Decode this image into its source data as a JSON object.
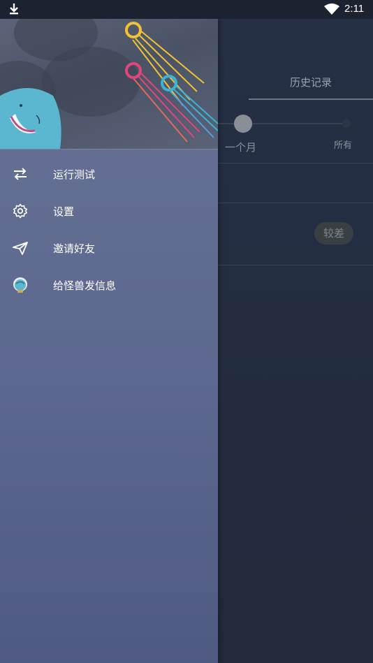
{
  "status_bar": {
    "time": "2:11"
  },
  "background": {
    "tab_history": "历史记录",
    "slider": {
      "label_month": "一个月",
      "label_all": "所有"
    },
    "rating_badge": "较差"
  },
  "drawer": {
    "menu": [
      {
        "label": "运行测试",
        "icon": "swap-arrows-icon"
      },
      {
        "label": "设置",
        "icon": "gear-icon"
      },
      {
        "label": "邀请好友",
        "icon": "paper-plane-icon"
      },
      {
        "label": "给怪兽发信息",
        "icon": "monster-head-icon"
      }
    ]
  },
  "colors": {
    "drawer_top": "#677293",
    "drawer_bottom": "#4f5a82",
    "background": "#1f2636",
    "monster": "#5bb6cf",
    "comet_yellow": "#f2c230",
    "comet_pink": "#e2457a",
    "comet_cyan": "#3bb3d6"
  }
}
